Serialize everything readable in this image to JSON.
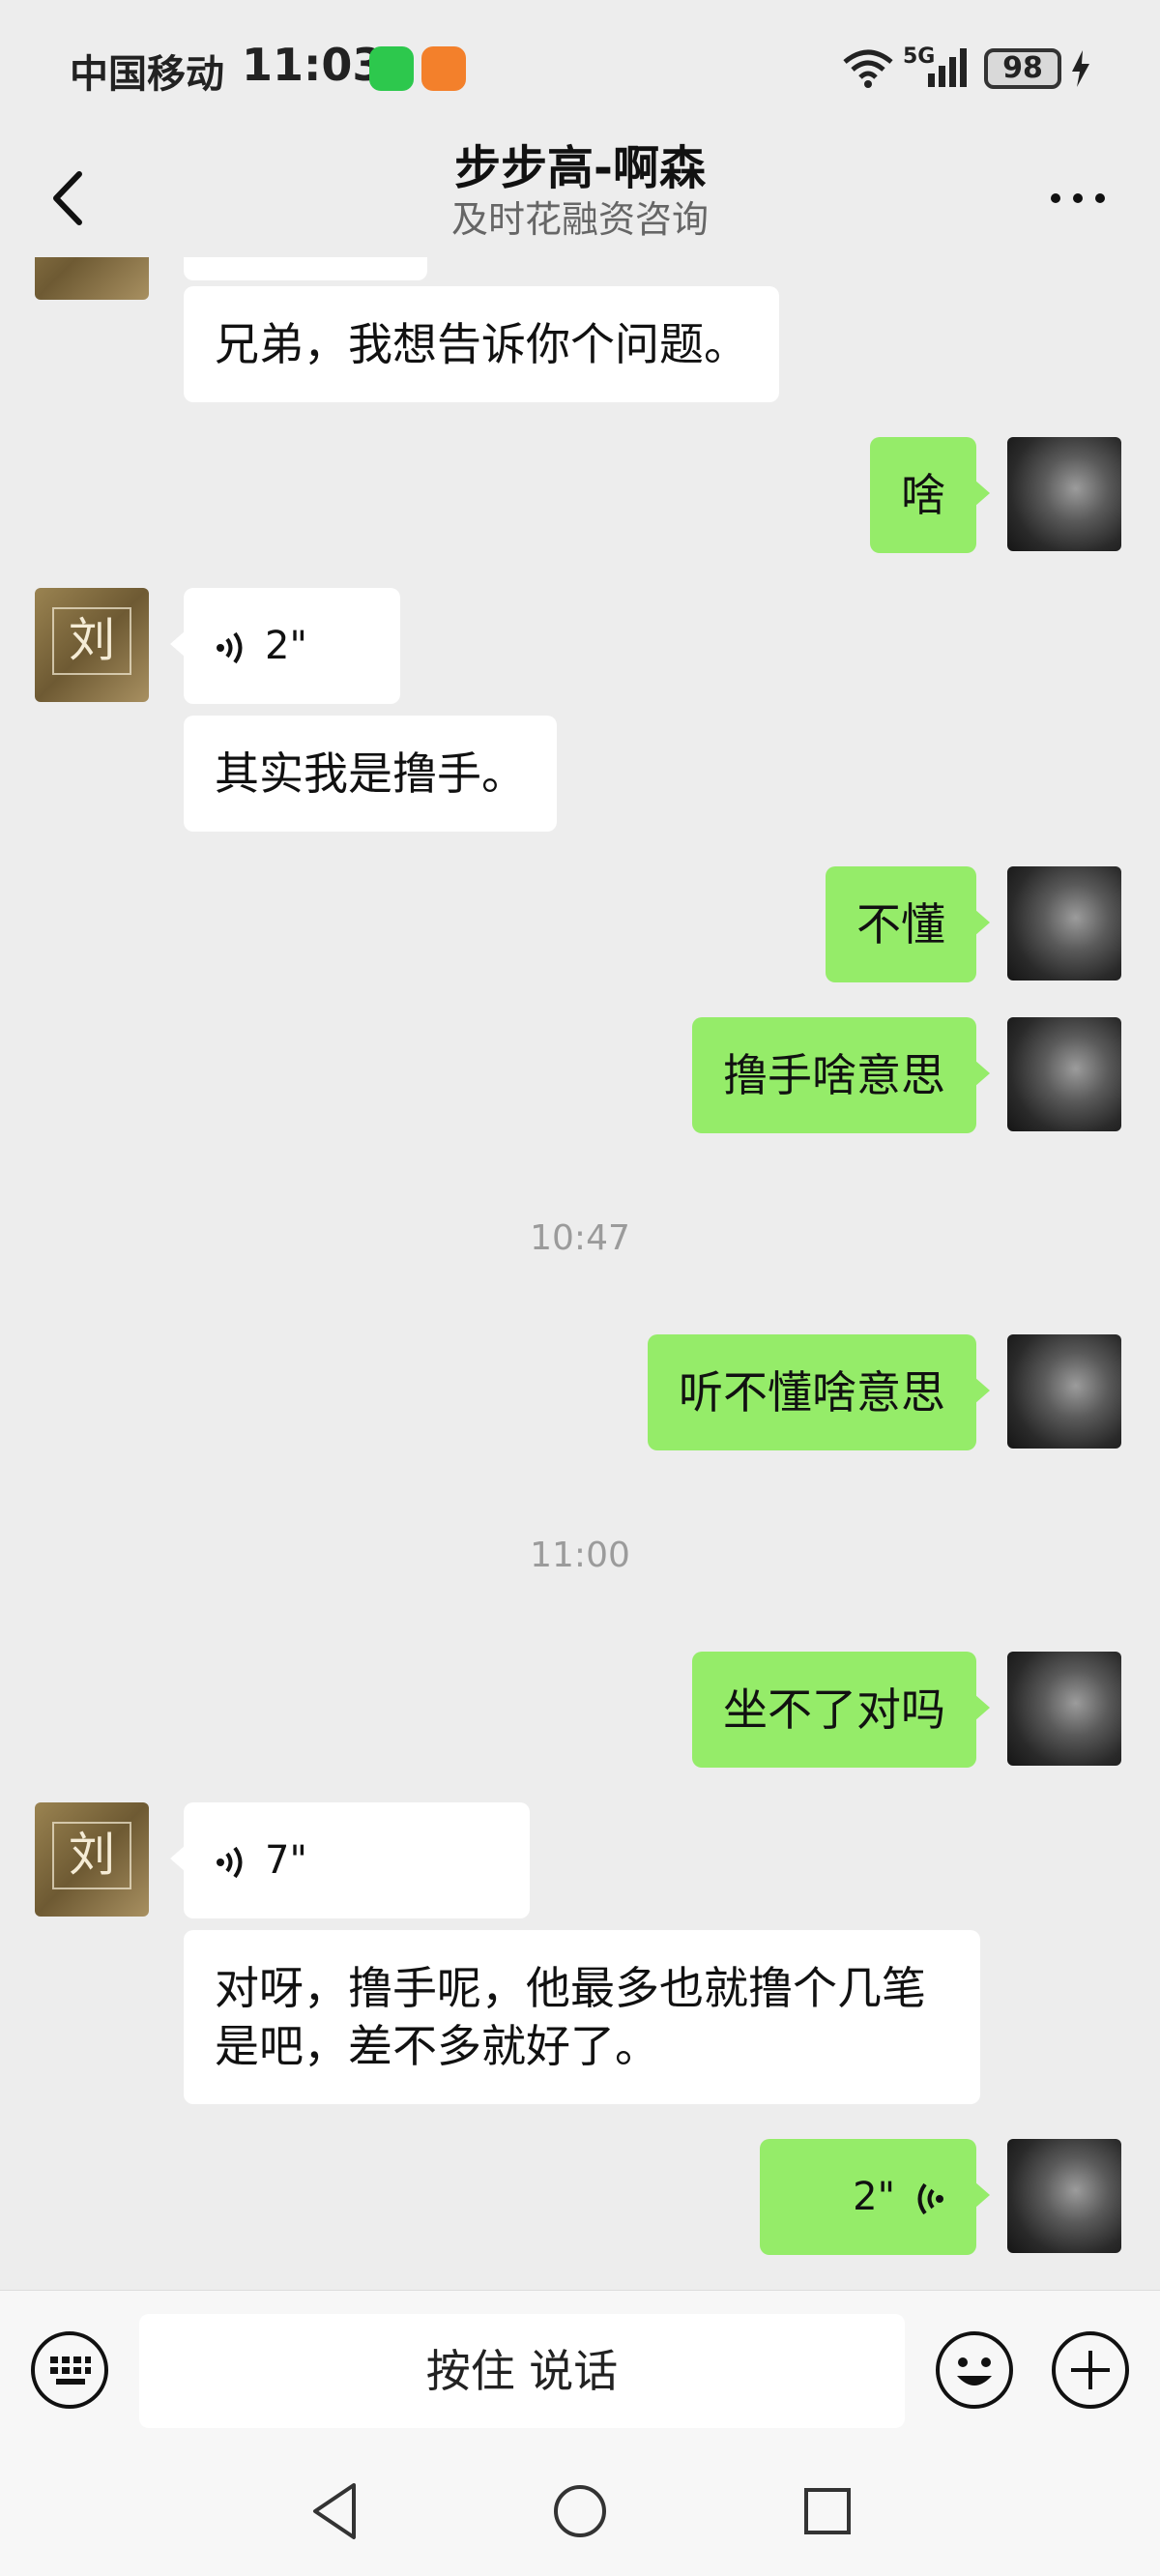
{
  "status_bar": {
    "carrier": "中国移动",
    "time": "11:03",
    "network": "5G",
    "battery": "98",
    "icons": [
      "wechat-app-icon",
      "shopping-app-icon",
      "wifi-icon",
      "signal-icon",
      "battery-icon",
      "charging-icon"
    ]
  },
  "header": {
    "title": "步步高-啊森",
    "subtitle": "及时花融资咨询",
    "back_icon": "chevron-left-icon",
    "more_icon": "more-dots-icon"
  },
  "messages": [
    {
      "id": "m1",
      "from": "them",
      "type": "text",
      "text": "兄弟，我想告诉你个问题。"
    },
    {
      "id": "m2",
      "from": "me",
      "type": "text",
      "text": "啥"
    },
    {
      "id": "m3",
      "from": "them",
      "type": "voice",
      "duration": "2\""
    },
    {
      "id": "m4",
      "from": "them",
      "type": "text",
      "text": "其实我是撸手。"
    },
    {
      "id": "m5",
      "from": "me",
      "type": "text",
      "text": "不懂"
    },
    {
      "id": "m6",
      "from": "me",
      "type": "text",
      "text": "撸手啥意思"
    },
    {
      "id": "t1",
      "type": "timestamp",
      "text": "10:47"
    },
    {
      "id": "m7",
      "from": "me",
      "type": "text",
      "text": "听不懂啥意思"
    },
    {
      "id": "t2",
      "type": "timestamp",
      "text": "11:00"
    },
    {
      "id": "m8",
      "from": "me",
      "type": "text",
      "text": "坐不了对吗"
    },
    {
      "id": "m9",
      "from": "them",
      "type": "voice",
      "duration": "7\""
    },
    {
      "id": "m10",
      "from": "them",
      "type": "text",
      "text": "对呀，撸手呢，他最多也就撸个几笔是吧，差不多就好了。"
    },
    {
      "id": "m11",
      "from": "me",
      "type": "voice",
      "duration": "2\""
    }
  ],
  "input_bar": {
    "hold_to_talk": "按住 说话",
    "left_icon": "keyboard-icon",
    "emoji_icon": "emoji-icon",
    "plus_icon": "plus-circle-icon"
  },
  "avatars": {
    "them_glyph": "刘"
  },
  "colors": {
    "background": "#ededed",
    "outgoing_bubble": "#95ec69",
    "incoming_bubble": "#ffffff",
    "timestamp_text": "#9b9b9b"
  }
}
